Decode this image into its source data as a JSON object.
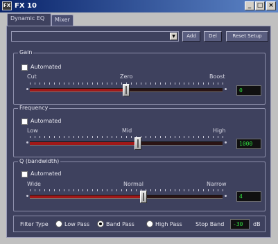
{
  "window": {
    "title": "FX 10",
    "icon": "app-icon",
    "min_glyph": "_",
    "max_glyph": "□",
    "close_glyph": "×"
  },
  "tabs": [
    {
      "label": "Dynamic EQ",
      "active": true
    },
    {
      "label": "Mixer",
      "active": false
    }
  ],
  "toolbar": {
    "preset_value": "",
    "add_label": "Add",
    "del_label": "Del",
    "reset_label": "Reset Setup"
  },
  "gain": {
    "legend": "Gain",
    "automated_label": "Automated",
    "automated": false,
    "left_label": "Cut",
    "center_label": "Zero",
    "right_label": "Boost",
    "value": "0",
    "position": 0.5
  },
  "frequency": {
    "legend": "Frequency",
    "automated_label": "Automated",
    "automated": false,
    "left_label": "Low",
    "center_label": "Mid",
    "right_label": "High",
    "value": "1000",
    "position": 0.56
  },
  "q": {
    "legend": "Q (bandwidth)",
    "automated_label": "Automated",
    "automated": false,
    "left_label": "Wide",
    "center_label": "Normal",
    "right_label": "Narrow",
    "value": "4",
    "position": 0.59
  },
  "filter": {
    "type_label": "Filter Type",
    "options": [
      "Low Pass",
      "Band Pass",
      "High Pass"
    ],
    "selected": "Band Pass",
    "stop_band_label": "Stop Band",
    "stop_band_value": "-30",
    "stop_band_unit": "dB"
  },
  "colors": {
    "panel": "#3e415e",
    "slider_fill": "#a01818",
    "lcd_text": "#30e040"
  }
}
